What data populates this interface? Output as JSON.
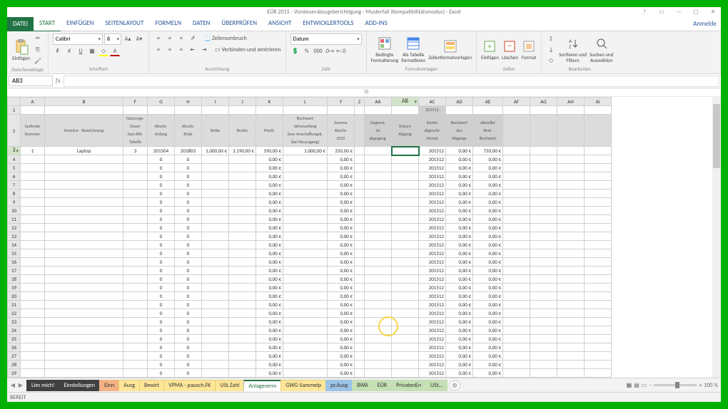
{
  "title": "EÜR 2015 - Vorsteuerabzugsberichtigung - Musterfall (Kompatibilitätsmodus) - Excel",
  "signin": "Anmelde",
  "tabs": {
    "file": "DATEI",
    "items": [
      "START",
      "EINFÜGEN",
      "SEITENLAYOUT",
      "FORMELN",
      "DATEN",
      "ÜBERPRÜFEN",
      "ANSICHT",
      "ENTWICKLERTOOLS",
      "ADD-INS"
    ]
  },
  "ribbon": {
    "clipboard": {
      "label": "Zwischenablage",
      "paste": "Einfügen"
    },
    "font": {
      "label": "Schriftart",
      "name": "Calibri",
      "size": "8"
    },
    "alignment": {
      "label": "Ausrichtung",
      "wrap": "Zeilenumbruch",
      "merge": "Verbinden und zentrieren"
    },
    "number": {
      "label": "Zahl",
      "format": "Datum"
    },
    "styles": {
      "label": "Formatvorlagen",
      "cond": "Bedingte\nFormatierung",
      "astable": "Als Tabelle\nformatieren",
      "cellstyles": "Zellenformatvorlagen"
    },
    "cells": {
      "label": "Zellen",
      "insert": "Einfügen",
      "delete": "Löschen",
      "format": "Format"
    },
    "editing": {
      "label": "Bearbeiten",
      "sort": "Sortieren und\nFiltern",
      "find": "Suchen und\nAuswählen"
    }
  },
  "formula_bar": {
    "name_box": "AB3",
    "fx": "fx",
    "formula": ""
  },
  "columns": [
    "A",
    "B",
    "F",
    "G",
    "H",
    "I",
    "J",
    "K",
    "L",
    "Y",
    "Z",
    "AA",
    "AB",
    "AC",
    "AD",
    "AE",
    "AF",
    "AG",
    "AH",
    "AI"
  ],
  "selected_col": "AB",
  "header_sub_ab": "201512",
  "headers": {
    "A": "laufende\nNummer",
    "B": "Inventar - Bezeichnung",
    "F": "Nutzungs-\nDauer\nlaut AfA-\nTabelle",
    "G": "Abschr.\nAnfang",
    "H": "Abschr.\nEnde",
    "I": "Netto",
    "J": "Brutto",
    "K": "MwSt.",
    "L": "Buchwert\nJahresanfang\nbzw. Anschaffungsk.\n(bei Neuzugang)",
    "Y": "Summe\nAbschr.\n2015",
    "Z": "",
    "AA": "Gegenst.\nist\nabgegang.",
    "AB": "Datum\nAbgang",
    "AC": "letzter\nabgeschr.\nMonat",
    "AD": "Buchwert\ndes\nAbgangs",
    "AE": "aktueller\nRest-\nBuchwert"
  },
  "first_row": {
    "A": "1",
    "B": "Laptop",
    "F": "3",
    "G": "201504",
    "H": "201803",
    "I": "1.000,00 €",
    "J": "1.190,00 €",
    "K": "190,00 €",
    "L": "1.000,00 €",
    "Y": "250,00 €",
    "AC": "201512",
    "AD": "0,00 €",
    "AE": "750,00 €"
  },
  "repeat_row": {
    "G": "0",
    "H": "0",
    "K": "0,00 €",
    "Y": "0,00 €",
    "AC": "201512",
    "AD": "0,00 €",
    "AE": "0,00 €"
  },
  "row_count": 33,
  "sheet_tabs": [
    {
      "name": "Lies mich!",
      "cls": "black"
    },
    {
      "name": "Einstellungen",
      "cls": "black"
    },
    {
      "name": "Einn",
      "cls": "orange"
    },
    {
      "name": "Ausg",
      "cls": "yellow"
    },
    {
      "name": "Bewirt",
      "cls": "yellow"
    },
    {
      "name": "VPMA - pausch.FK",
      "cls": "yellow"
    },
    {
      "name": "USt.Zahl",
      "cls": "yellow"
    },
    {
      "name": "Anlageverm",
      "cls": "active"
    },
    {
      "name": "GWG-Sammelp",
      "cls": "yellow"
    },
    {
      "name": "pr.Ausg",
      "cls": "blue"
    },
    {
      "name": "BWA",
      "cls": "green"
    },
    {
      "name": "EÜR",
      "cls": "green"
    },
    {
      "name": "PrivatenEn",
      "cls": "green"
    },
    {
      "name": "USt…",
      "cls": "green"
    }
  ],
  "status": "BEREIT",
  "zoom": "100 %"
}
